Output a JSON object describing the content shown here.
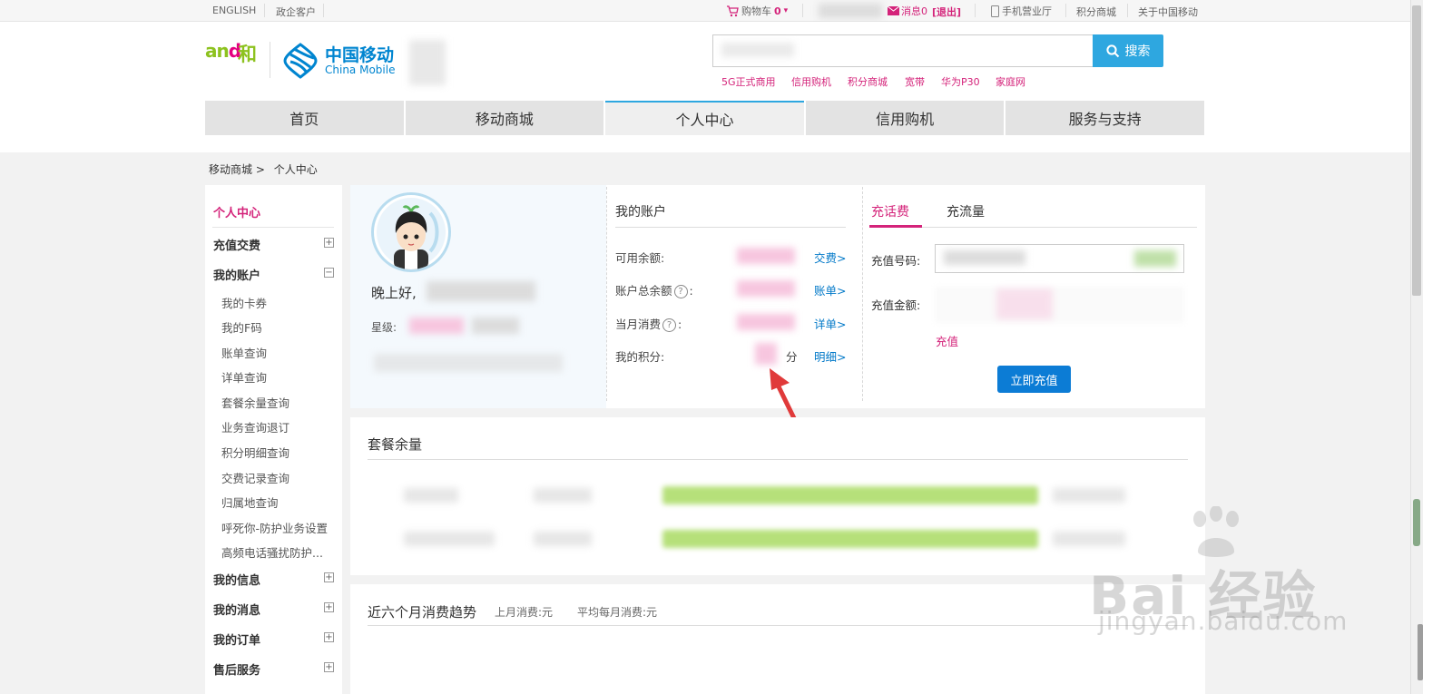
{
  "topbar": {
    "lang": "ENGLISH",
    "enterprise": "政企客户",
    "cart_label": "购物车",
    "cart_count": "0",
    "message_label": "消息0",
    "logout": "[退出]",
    "mobile_hall": "手机营业厅",
    "points_mall": "积分商城",
    "about": "关于中国移动"
  },
  "header": {
    "logo_and": "and",
    "logo_he": "和",
    "cm_cn": "中国移动",
    "cm_en": "China Mobile",
    "search_button": "搜索",
    "hot_links": [
      "5G正式商用",
      "信用购机",
      "积分商城",
      "宽带",
      "华为P30",
      "家庭网"
    ]
  },
  "nav": {
    "items": [
      "首页",
      "移动商城",
      "个人中心",
      "信用购机",
      "服务与支持"
    ],
    "active_index": 2
  },
  "breadcrumb": {
    "parent": "移动商城",
    "separator": ">",
    "current": "个人中心"
  },
  "sidebar": {
    "title": "个人中心",
    "recharge": "充值交费",
    "account": "我的账户",
    "account_items": [
      "我的卡券",
      "我的F码",
      "账单查询",
      "详单查询",
      "套餐余量查询",
      "业务查询退订",
      "积分明细查询",
      "交费记录查询",
      "归属地查询",
      "呼死你-防护业务设置",
      "高频电话骚扰防护..."
    ],
    "info": "我的信息",
    "messages": "我的消息",
    "orders": "我的订单",
    "after_sales": "售后服务"
  },
  "user": {
    "greeting": "晚上好,",
    "star_label": "星级:"
  },
  "account": {
    "title": "我的账户",
    "available_label": "可用余额:",
    "available_link": "交费>",
    "total_label": "账户总余额",
    "total_link": "账单>",
    "month_label": "当月消费",
    "month_link": "详单>",
    "points_label": "我的积分:",
    "points_unit": "分",
    "points_link": "明细>",
    "help_glyph": "?",
    "colon": ":"
  },
  "recharge": {
    "tab_fee": "充话费",
    "tab_data": "充流量",
    "number_label": "充值号码:",
    "amount_label": "充值金额:",
    "recharge_link": "充值",
    "submit": "立即充值"
  },
  "package": {
    "title": "套餐余量"
  },
  "trend": {
    "title": "近六个月消费趋势",
    "last_month": "上月消费:元",
    "avg_month": "平均每月消费:元"
  },
  "watermark": {
    "main": "Bai 经验",
    "sub": "jingyan.baidu.com"
  },
  "colors": {
    "accent_pink": "#d4237a",
    "accent_blue": "#2ea7e0",
    "link_blue": "#0078c8",
    "button_blue": "#0c7cd5",
    "green": "#8dc21f"
  }
}
